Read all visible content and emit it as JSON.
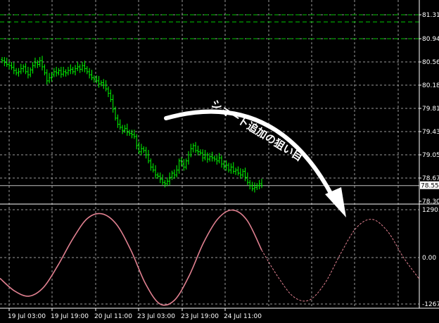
{
  "chart_data": [
    {
      "type": "candlestick",
      "panel": "price",
      "colors": {
        "background": "#000000",
        "candles": "#00ff00",
        "grid": "#9a9a9a",
        "hline": "#00c800",
        "price_line": "#c0c0c0",
        "annotation": "#ffffff"
      },
      "grid": true,
      "y_ticks": [
        "81.31",
        "80.94",
        "80.56",
        "80.18",
        "79.81",
        "79.43",
        "79.05",
        "78.67",
        "78.30"
      ],
      "ylim": [
        78.3,
        81.4
      ],
      "current_price_label": "78.55",
      "current_price": 78.55,
      "horizontal_lines": [
        81.2,
        81.31,
        80.94
      ],
      "series_close": [
        80.58,
        80.55,
        80.52,
        80.5,
        80.47,
        80.42,
        80.38,
        80.4,
        80.45,
        80.48,
        80.4,
        80.35,
        80.43,
        80.5,
        80.55,
        80.52,
        80.58,
        80.48,
        80.38,
        80.25,
        80.3,
        80.35,
        80.4,
        80.38,
        80.42,
        80.36,
        80.4,
        80.38,
        80.42,
        80.44,
        80.4,
        80.45,
        80.48,
        80.44,
        80.5,
        80.45,
        80.4,
        80.35,
        80.3,
        80.28,
        80.25,
        80.2,
        80.22,
        80.18,
        80.12,
        80.05,
        79.95,
        79.8,
        79.65,
        79.55,
        79.5,
        79.45,
        79.48,
        79.42,
        79.4,
        79.38,
        79.35,
        79.2,
        79.1,
        79.15,
        79.12,
        79.05,
        78.95,
        78.85,
        78.8,
        78.72,
        78.7,
        78.65,
        78.6,
        78.58,
        78.62,
        78.68,
        78.75,
        78.72,
        78.8,
        78.95,
        78.9,
        78.85,
        78.95,
        79.05,
        79.15,
        79.2,
        79.12,
        79.1,
        79.08,
        79.0,
        79.05,
        78.98,
        79.02,
        79.0,
        78.98,
        78.95,
        79.0,
        78.9,
        78.85,
        78.88,
        78.8,
        78.85,
        78.78,
        78.8,
        78.75,
        78.72,
        78.78,
        78.68,
        78.6,
        78.55,
        78.5,
        78.52,
        78.55,
        78.58,
        78.55
      ],
      "annotation": "ショート追加の狙い目"
    },
    {
      "type": "line",
      "panel": "oscillator",
      "colors": {
        "line": "#e08090"
      },
      "y_ticks": [
        "1290.",
        "0.00",
        "-1267"
      ],
      "ylim": [
        -1267,
        1290
      ],
      "x_ticks": [
        "19 Jul 03:00",
        "19 Jul 19:00",
        "20 Jul 11:00",
        "23 Jul 03:00",
        "23 Jul 19:00",
        "24 Jul 11:00"
      ],
      "series": [
        {
          "style": "solid",
          "values": [
            -560,
            -900,
            -1040,
            -800,
            -200,
            500,
            1050,
            1180,
            900,
            200,
            -700,
            -1250,
            -1150,
            -500,
            400,
            1050,
            1280,
            1000,
            200
          ]
        },
        {
          "style": "dashed",
          "values": [
            200,
            -500,
            -1050,
            -1150,
            -700,
            100,
            800,
            1030,
            700,
            0,
            -580
          ]
        }
      ]
    }
  ]
}
